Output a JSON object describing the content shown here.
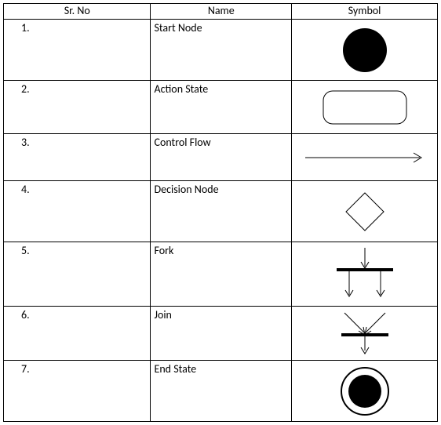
{
  "headers": {
    "sr": "Sr. No",
    "name": "Name",
    "symbol": "Symbol"
  },
  "rows": [
    {
      "sr": "1.",
      "name": "Start Node",
      "symbol_kind": "start-node"
    },
    {
      "sr": "2.",
      "name": "Action State",
      "symbol_kind": "action-state"
    },
    {
      "sr": "3.",
      "name": "Control Flow",
      "symbol_kind": "control-flow"
    },
    {
      "sr": "4.",
      "name": "Decision Node",
      "symbol_kind": "decision-node"
    },
    {
      "sr": "5.",
      "name": "Fork",
      "symbol_kind": "fork"
    },
    {
      "sr": "6.",
      "name": "Join",
      "symbol_kind": "join"
    },
    {
      "sr": "7.",
      "name": "End State",
      "symbol_kind": "end-state"
    }
  ]
}
